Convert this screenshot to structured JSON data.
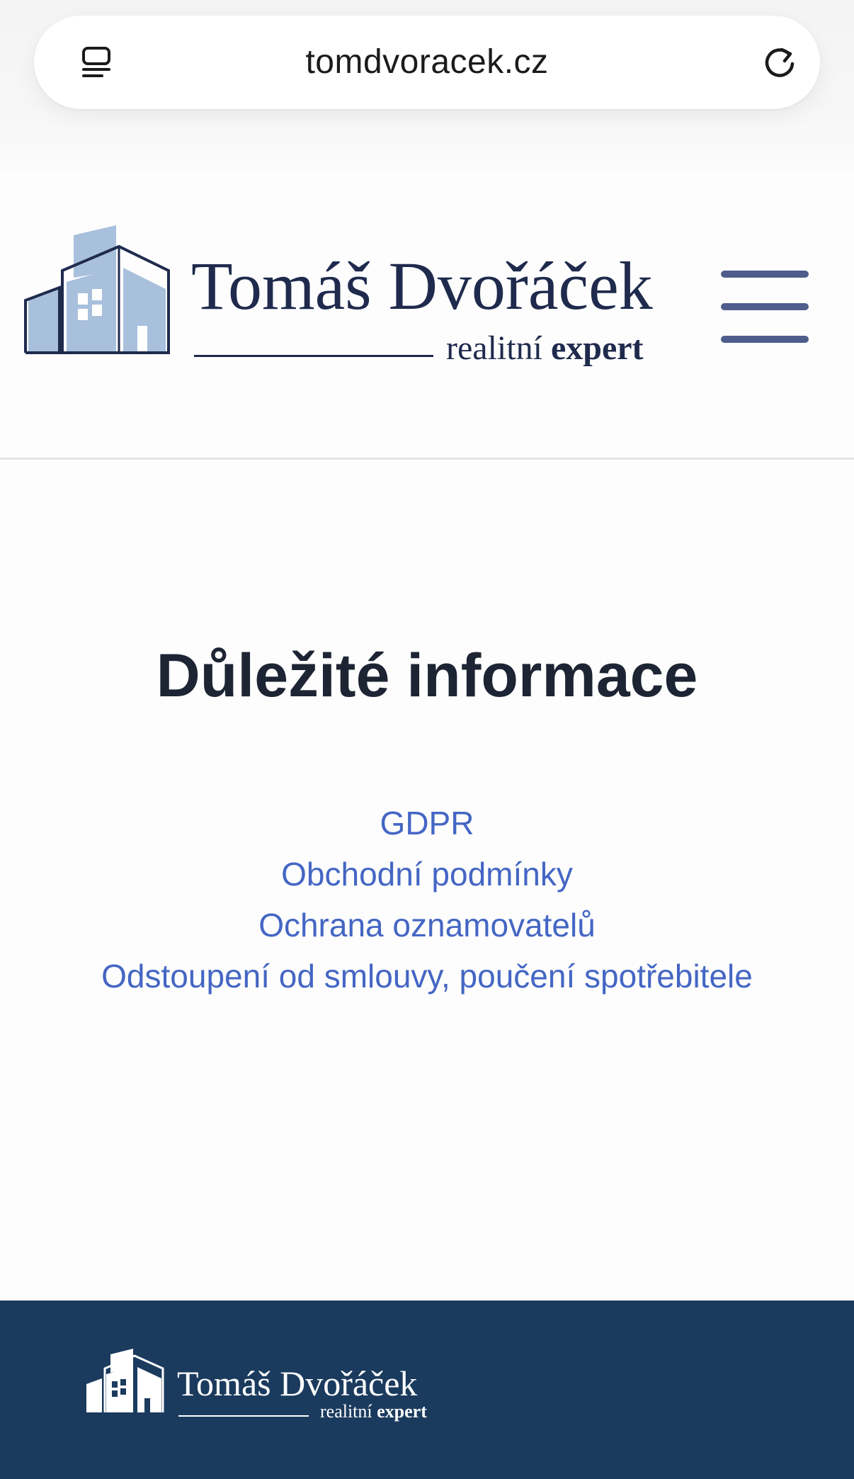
{
  "browser": {
    "url": "tomdvoracek.cz",
    "tabs_icon": "tabs-icon",
    "reload_icon": "reload-icon"
  },
  "header": {
    "logo": {
      "name": "Tomáš Dvořáček",
      "tagline_light": "realitní",
      "tagline_bold": "expert"
    },
    "menu_icon": "hamburger-menu-icon"
  },
  "main": {
    "title": "Důležité informace",
    "links": [
      "GDPR",
      "Obchodní podmínky",
      "Ochrana oznamovatelů",
      "Odstoupení od smlouvy, poučení spotřebitele"
    ]
  },
  "footer": {
    "logo": {
      "name": "Tomáš Dvořáček",
      "tagline_light": "realitní",
      "tagline_bold": "expert"
    }
  },
  "colors": {
    "brand_navy": "#1f2a4d",
    "logo_light_blue": "#a8c0dc",
    "link_blue": "#4466c4",
    "menu_icon": "#4e5d8c",
    "footer_bg": "#1b3b5e"
  }
}
